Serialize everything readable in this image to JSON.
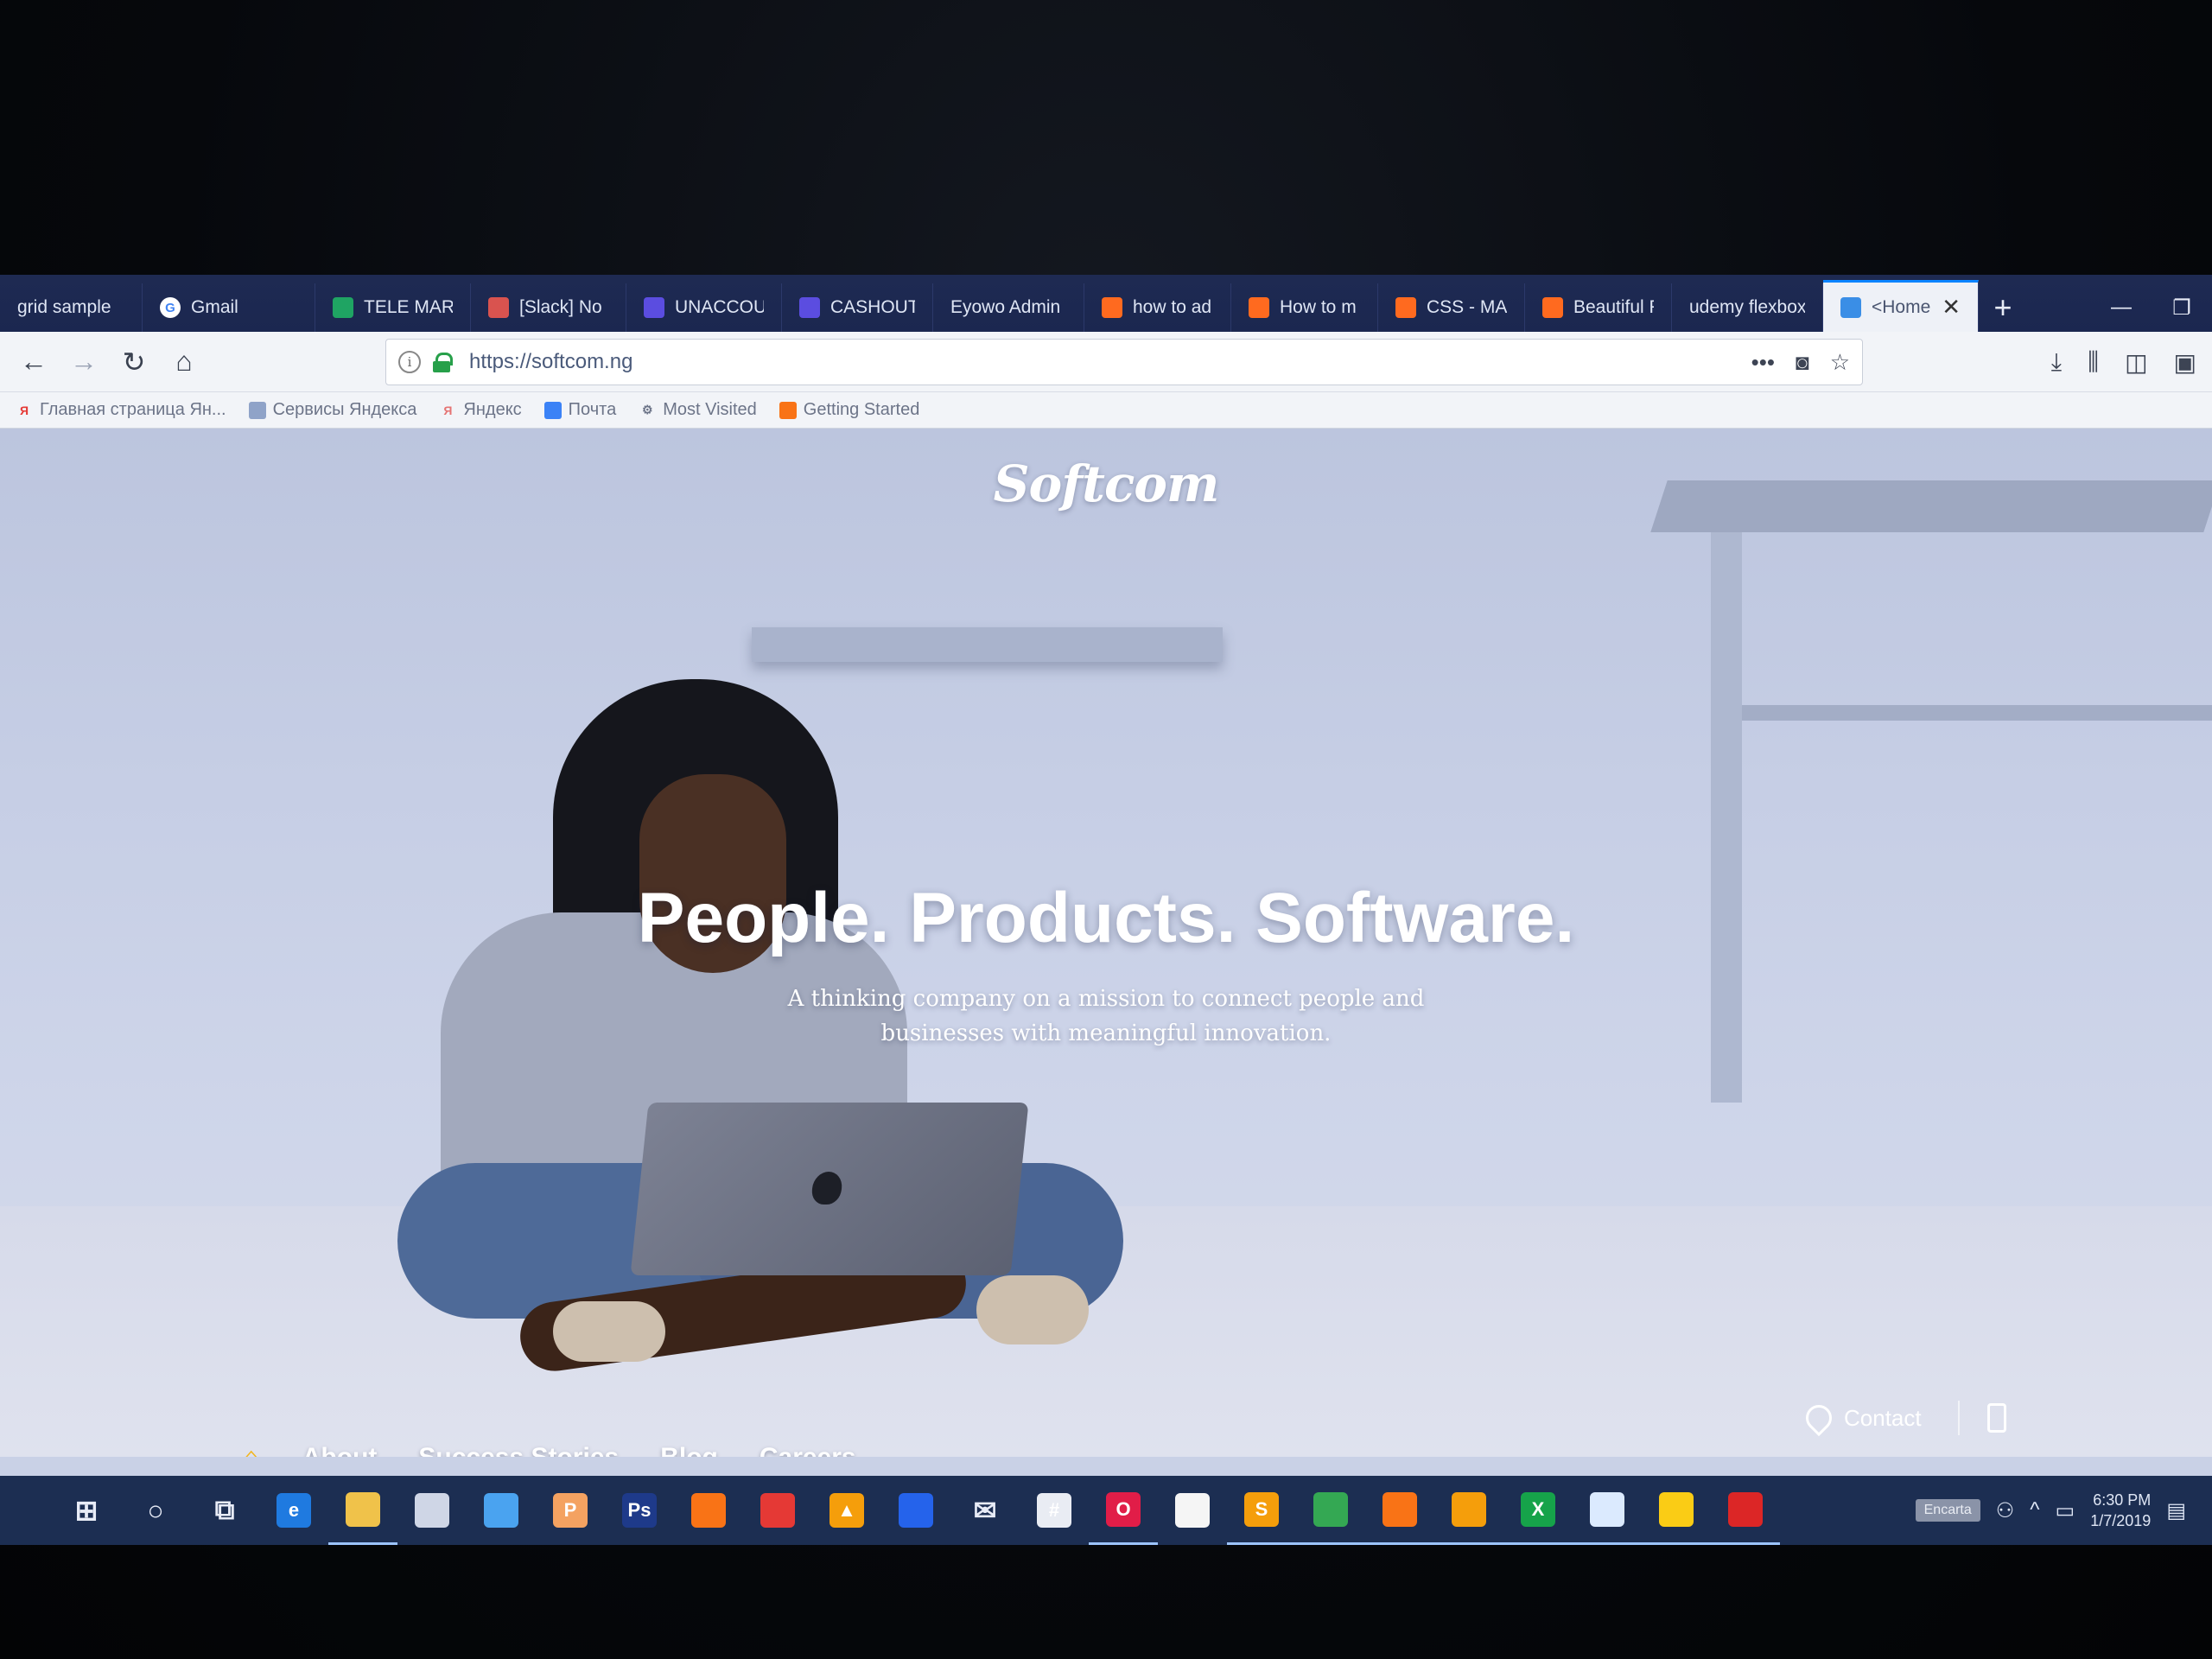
{
  "browser": {
    "tabs": [
      {
        "label": "grid sample",
        "icon": "none",
        "color": ""
      },
      {
        "label": "Gmail",
        "icon": "google-icon",
        "color": "#ffffff"
      },
      {
        "label": "TELE MAR",
        "icon": "sheets-icon",
        "color": "#1fa463"
      },
      {
        "label": "[Slack] No",
        "icon": "mail-icon",
        "color": "#d9534f"
      },
      {
        "label": "UNACCOU",
        "icon": "form-icon",
        "color": "#5b4de0"
      },
      {
        "label": "CASHOUT",
        "icon": "form-icon",
        "color": "#5b4de0"
      },
      {
        "label": "Eyowo Admin",
        "icon": "none",
        "color": ""
      },
      {
        "label": "how to ad",
        "icon": "video-icon",
        "color": "#ff6a1f"
      },
      {
        "label": "How to m",
        "icon": "video-icon",
        "color": "#ff6a1f"
      },
      {
        "label": "CSS - MAS",
        "icon": "video-icon",
        "color": "#ff6a1f"
      },
      {
        "label": "Beautiful F",
        "icon": "video-icon",
        "color": "#ff6a1f"
      },
      {
        "label": "udemy flexbox",
        "icon": "none",
        "color": ""
      }
    ],
    "active_tab": {
      "label": "<Home",
      "icon": "page-icon",
      "color": "#3a8ee6"
    },
    "new_tab_symbol": "+",
    "url": "https://softcom.ng",
    "url_actions": {
      "more": "•••",
      "pocket": "pocket-icon",
      "bookmark": "☆"
    },
    "toolbar_icons": [
      "download-icon",
      "library-icon",
      "sidebar-icon",
      "screenshot-icon"
    ],
    "bookmarks": [
      {
        "label": "Главная страница Ян...",
        "icon": "yandex-icon",
        "color": "#e53935",
        "glyph": "Я"
      },
      {
        "label": "Сервисы Яндекса",
        "icon": "folder-icon",
        "color": "#8fa3c8",
        "glyph": ""
      },
      {
        "label": "Яндекс",
        "icon": "yandex-icon",
        "color": "#e57373",
        "glyph": "Я"
      },
      {
        "label": "Почта",
        "icon": "mail-icon",
        "color": "#3b82f6",
        "glyph": ""
      },
      {
        "label": "Most Visited",
        "icon": "gear-icon",
        "color": "#6c7488",
        "glyph": "⚙"
      },
      {
        "label": "Getting Started",
        "icon": "firefox-icon",
        "color": "#f97316",
        "glyph": ""
      }
    ]
  },
  "site": {
    "brand": "Softcom",
    "hero_title": "People. Products. Software.",
    "hero_subtitle": "A thinking company on a mission to connect people and businesses with meaningful innovation.",
    "nav": {
      "about": "About",
      "success": "Success Stories",
      "blog": "Blog",
      "careers": "Careers"
    },
    "contact": "Contact"
  },
  "taskbar": {
    "apps": [
      {
        "name": "start-icon",
        "glyph": "⊞",
        "color": "transparent",
        "running": false
      },
      {
        "name": "cortana-icon",
        "glyph": "○",
        "color": "transparent",
        "running": false
      },
      {
        "name": "task-view-icon",
        "glyph": "⧉",
        "color": "transparent",
        "running": false
      },
      {
        "name": "edge-icon",
        "glyph": "e",
        "color": "#1f7ae0",
        "running": false
      },
      {
        "name": "file-explorer-icon",
        "glyph": "",
        "color": "#f0c24a",
        "running": true
      },
      {
        "name": "store-icon",
        "glyph": "",
        "color": "#cfd6e6",
        "running": false
      },
      {
        "name": "bird-app-icon",
        "glyph": "",
        "color": "#4aa3f0",
        "running": false
      },
      {
        "name": "powerpoint-icon",
        "glyph": "P",
        "color": "#f4a261",
        "running": false
      },
      {
        "name": "photoshop-icon",
        "glyph": "Ps",
        "color": "#1e3a8a",
        "running": false
      },
      {
        "name": "firefox-app-icon",
        "glyph": "",
        "color": "#f97316",
        "running": false
      },
      {
        "name": "recorder-icon",
        "glyph": "",
        "color": "#e53935",
        "running": false
      },
      {
        "name": "vlc-icon",
        "glyph": "▲",
        "color": "#f59e0b",
        "running": false
      },
      {
        "name": "toefl-icon",
        "glyph": "",
        "color": "#2563eb",
        "running": false
      },
      {
        "name": "mail-app-icon",
        "glyph": "✉",
        "color": "transparent",
        "running": false
      },
      {
        "name": "slack-app-icon",
        "glyph": "#",
        "color": "#e9ecf3",
        "running": false
      },
      {
        "name": "opera-icon",
        "glyph": "O",
        "color": "#e11d48",
        "running": true
      },
      {
        "name": "notepad-icon",
        "glyph": "",
        "color": "#f5f5f5",
        "running": false
      },
      {
        "name": "sublime-icon",
        "glyph": "S",
        "color": "#f59e0b",
        "running": true
      },
      {
        "name": "chrome-icon",
        "glyph": "",
        "color": "#34a853",
        "running": true
      },
      {
        "name": "firefox-running-icon",
        "glyph": "",
        "color": "#f97316",
        "running": true
      },
      {
        "name": "app-active-icon",
        "glyph": "",
        "color": "#f59e0b",
        "running": true
      },
      {
        "name": "excel-icon",
        "glyph": "X",
        "color": "#16a34a",
        "running": true
      },
      {
        "name": "chat-icon",
        "glyph": "",
        "color": "#dbeafe",
        "running": true
      },
      {
        "name": "sticky-notes-icon",
        "glyph": "",
        "color": "#facc15",
        "running": true
      },
      {
        "name": "pdf-icon",
        "glyph": "",
        "color": "#dc2626",
        "running": true
      }
    ],
    "ime_label": "Encarta",
    "time": "6:30 PM",
    "date": "1/7/2019"
  }
}
